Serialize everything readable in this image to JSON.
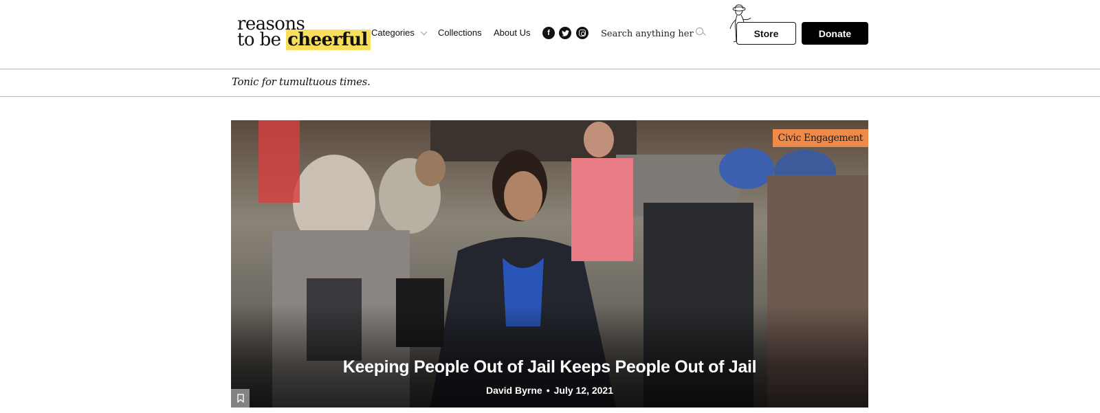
{
  "logo": {
    "line1": "reasons",
    "line2_prefix": "to be ",
    "line2_highlight": "cheerful"
  },
  "nav": {
    "categories": "Categories",
    "collections": "Collections",
    "about": "About Us"
  },
  "social": {
    "facebook_glyph": "f",
    "icons": [
      "facebook-icon",
      "twitter-icon",
      "instagram-icon"
    ]
  },
  "search": {
    "placeholder": "Search anything here..."
  },
  "buttons": {
    "store": "Store",
    "donate": "Donate"
  },
  "tagline": "Tonic for tumultuous times.",
  "hero": {
    "category": "Civic Engagement",
    "title": "Keeping People Out of Jail Keeps People Out of Jail",
    "author": "David Byrne",
    "separator": "•",
    "date": "July 12, 2021"
  },
  "colors": {
    "highlight": "#f7df5c",
    "badge": "#ef8a4a",
    "donate_bg": "#000000"
  }
}
